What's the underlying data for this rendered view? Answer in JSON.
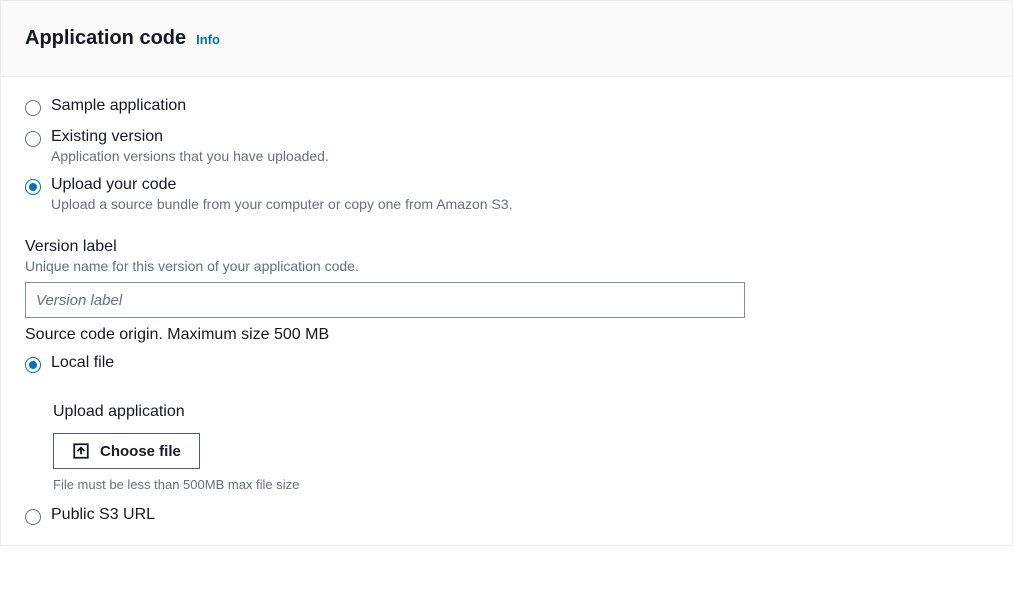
{
  "header": {
    "title": "Application code",
    "info_link": "Info"
  },
  "code_source_options": [
    {
      "label": "Sample application",
      "desc": "",
      "selected": false
    },
    {
      "label": "Existing version",
      "desc": "Application versions that you have uploaded.",
      "selected": false
    },
    {
      "label": "Upload your code",
      "desc": "Upload a source bundle from your computer or copy one from Amazon S3.",
      "selected": true
    }
  ],
  "version": {
    "label": "Version label",
    "desc": "Unique name for this version of your application code.",
    "placeholder": "Version label",
    "value": ""
  },
  "origin": {
    "label": "Source code origin. Maximum size 500 MB",
    "options": [
      {
        "label": "Local file",
        "selected": true
      },
      {
        "label": "Public S3 URL",
        "selected": false
      }
    ],
    "upload_label": "Upload application",
    "choose_file_button": "Choose file",
    "hint": "File must be less than 500MB max file size"
  }
}
